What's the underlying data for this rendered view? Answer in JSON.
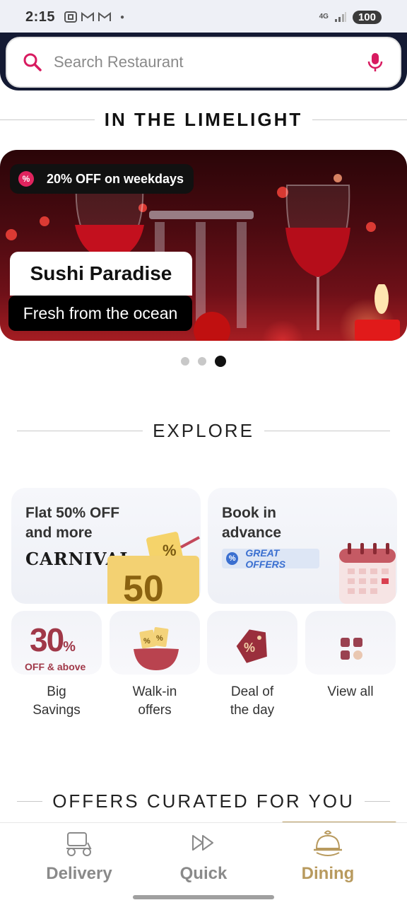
{
  "status_bar": {
    "time": "2:15",
    "network": "4G",
    "battery": "100"
  },
  "search": {
    "placeholder": "Search Restaurant"
  },
  "limelight": {
    "heading": "IN THE LIMELIGHT",
    "offer": "20% OFF on weekdays",
    "restaurant_name": "Sushi Paradise",
    "tagline": "Fresh from the ocean",
    "carousel_total": 3,
    "carousel_active_index": 2
  },
  "explore": {
    "heading": "EXPLORE",
    "cards": [
      {
        "title_line1": "Flat 50% OFF",
        "title_line2": "and more",
        "brand": "CARNIVAL",
        "art_number": "50"
      },
      {
        "title_line1": "Book in",
        "title_line2": "advance",
        "badge": "GREAT OFFERS"
      }
    ],
    "tiles": [
      {
        "line1": "Big",
        "line2": "Savings",
        "art_big": "30",
        "art_pct": "%",
        "art_caption": "OFF & above"
      },
      {
        "line1": "Walk-in",
        "line2": "offers"
      },
      {
        "line1": "Deal of",
        "line2": "the day"
      },
      {
        "line1": "View all",
        "line2": ""
      }
    ]
  },
  "offers_curated": {
    "heading": "OFFERS CURATED FOR YOU"
  },
  "bottom_nav": {
    "items": [
      {
        "label": "Delivery",
        "icon": "scooter-icon",
        "active": false
      },
      {
        "label": "Quick",
        "icon": "fast-forward-icon",
        "active": false
      },
      {
        "label": "Dining",
        "icon": "cloche-icon",
        "active": true
      }
    ],
    "accent": "#b89a5e"
  },
  "colors": {
    "header_bg": "#141a33",
    "search_icon": "#d81b60",
    "offer_badge": "#e0245e"
  }
}
